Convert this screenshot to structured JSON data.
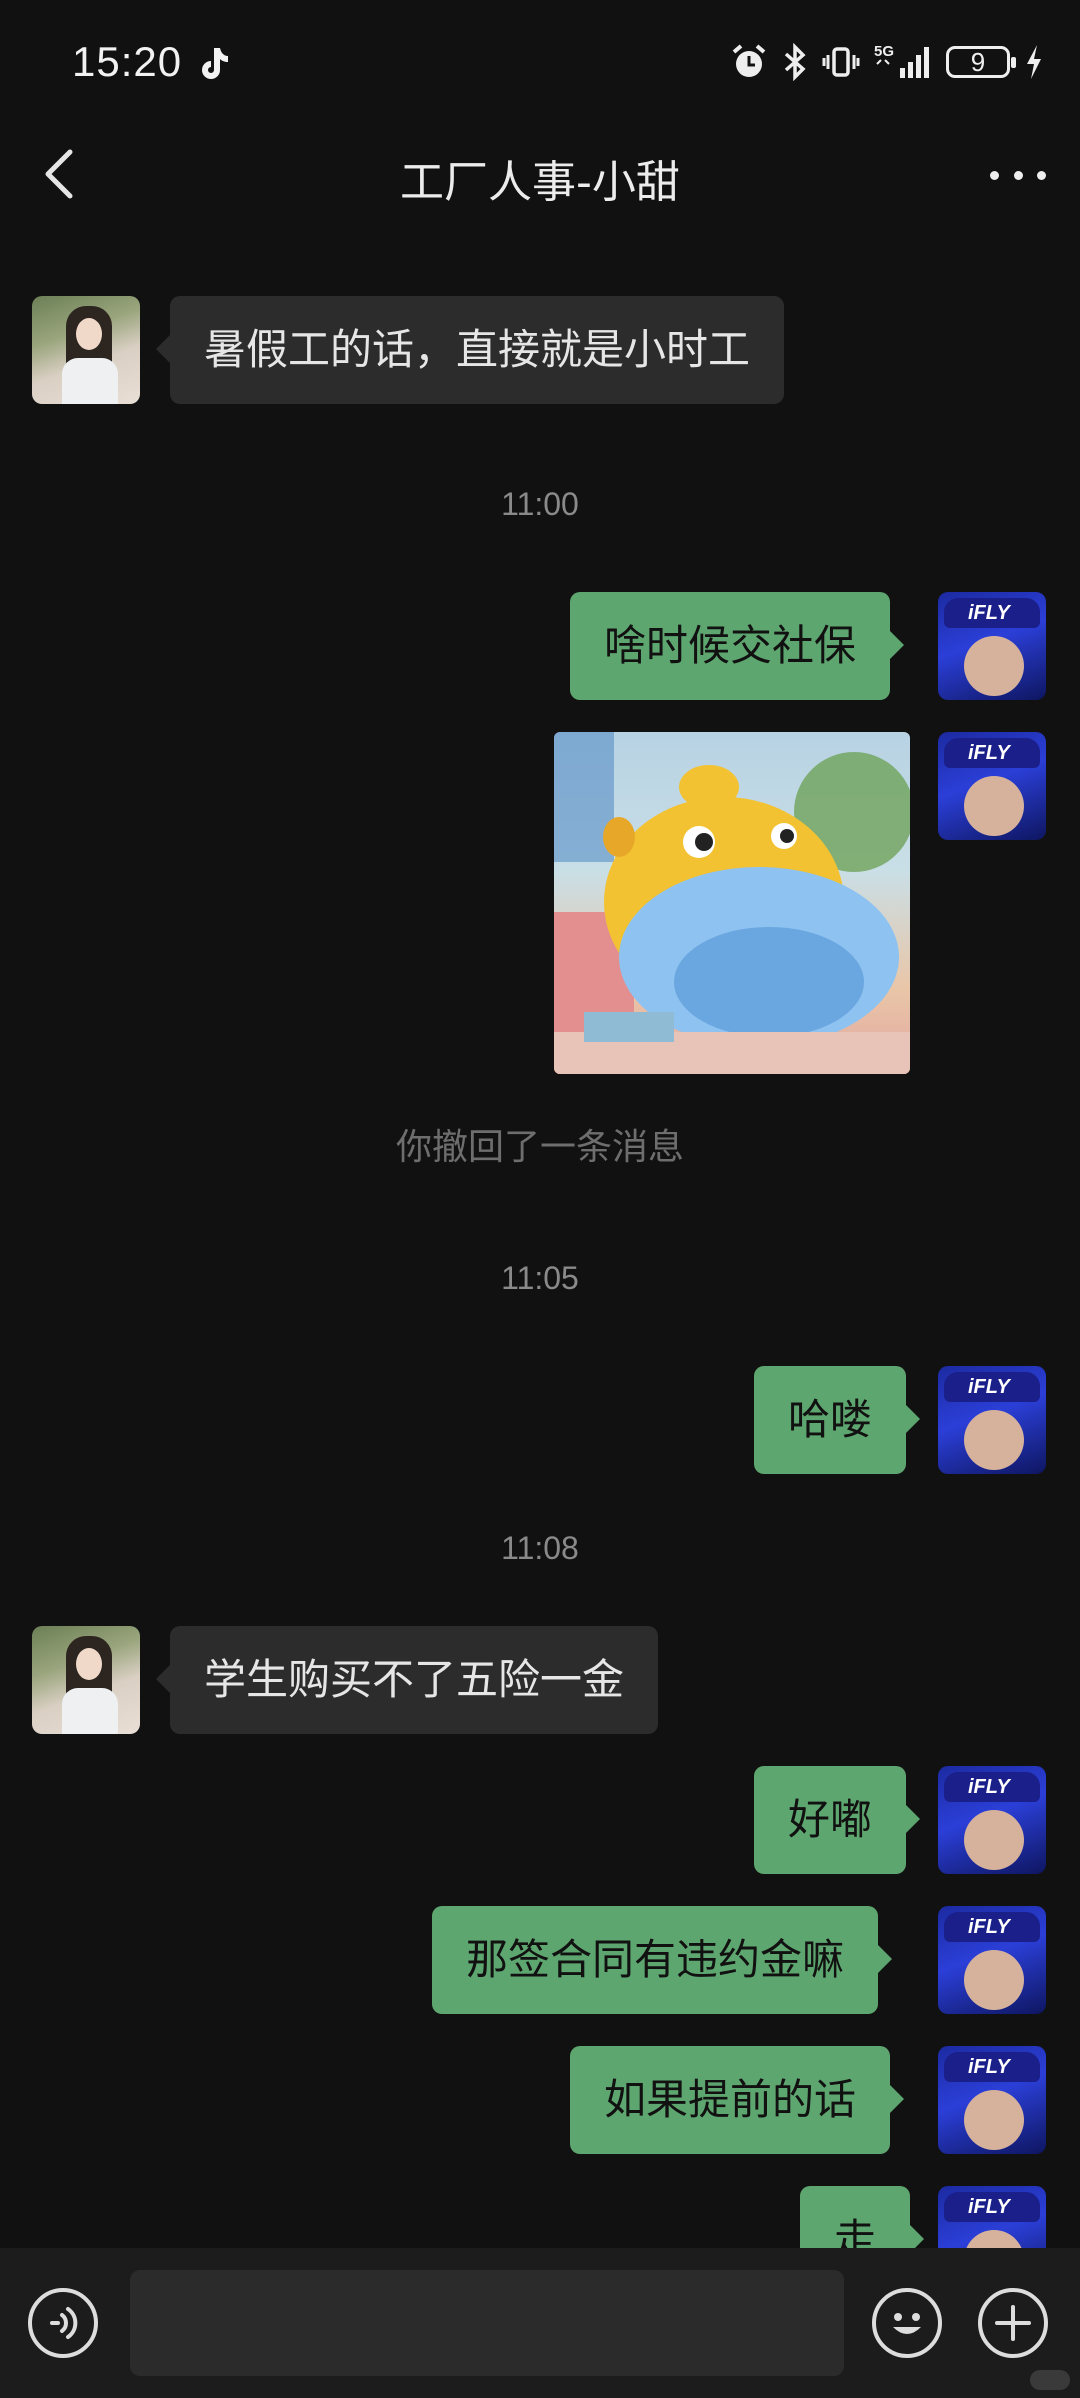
{
  "status_bar": {
    "time": "15:20",
    "network": "5G",
    "battery": "9",
    "icons": [
      "tiktok-icon",
      "alarm-icon",
      "bluetooth-icon",
      "vibrate-icon",
      "signal-icon",
      "battery-icon",
      "charging-icon"
    ]
  },
  "header": {
    "title": "工厂人事-小甜",
    "back_icon": "chevron-left-icon",
    "more_icon": "more-dots-icon"
  },
  "messages": [
    {
      "side": "in",
      "type": "text",
      "text": "暑假工的话，直接就是小时工"
    },
    {
      "type": "timestamp",
      "text": "11:00"
    },
    {
      "side": "out",
      "type": "text",
      "text": "啥时候交社保"
    },
    {
      "side": "out",
      "type": "image",
      "description": "yellow cartoon sticker"
    },
    {
      "type": "system",
      "text": "你撤回了一条消息"
    },
    {
      "type": "timestamp",
      "text": "11:05"
    },
    {
      "side": "out",
      "type": "text",
      "text": "哈喽"
    },
    {
      "type": "timestamp",
      "text": "11:08"
    },
    {
      "side": "in",
      "type": "text",
      "text": "学生购买不了五险一金"
    },
    {
      "side": "out",
      "type": "text",
      "text": "好嘟"
    },
    {
      "side": "out",
      "type": "text",
      "text": "那签合同有违约金嘛"
    },
    {
      "side": "out",
      "type": "text",
      "text": "如果提前的话"
    },
    {
      "side": "out",
      "type": "text",
      "text": "走"
    }
  ],
  "input_bar": {
    "placeholder": "",
    "icons": [
      "voice-icon",
      "emoji-icon",
      "plus-icon"
    ]
  },
  "colors": {
    "background": "#111111",
    "incoming_bubble": "#2c2c2c",
    "outgoing_bubble": "#5ea66f",
    "input_bar": "#1c1c1c"
  }
}
